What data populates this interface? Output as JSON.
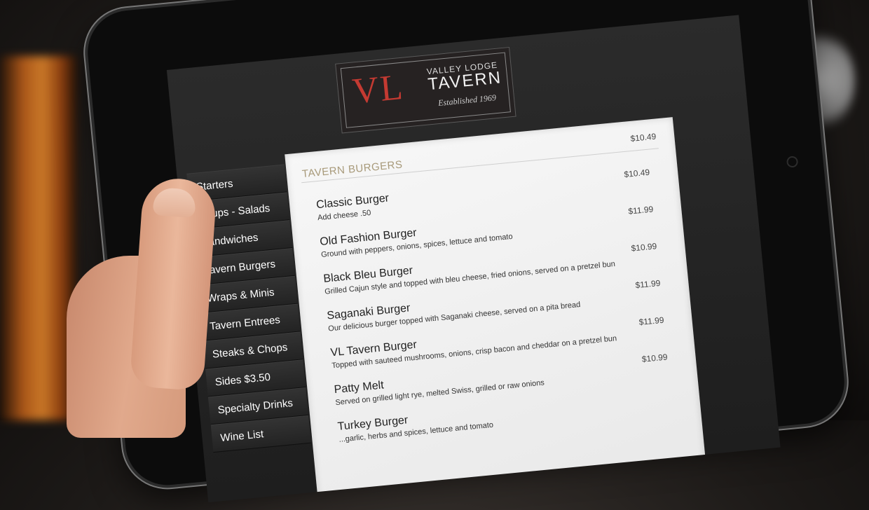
{
  "logo": {
    "initials": "VL",
    "line1": "VALLEY LODGE",
    "line2": "TAVERN",
    "tagline": "Established 1969"
  },
  "nav": [
    {
      "label": "Starters"
    },
    {
      "label": "Soups - Salads"
    },
    {
      "label": "Sandwiches"
    },
    {
      "label": "Tavern Burgers"
    },
    {
      "label": "Wraps & Minis"
    },
    {
      "label": "Tavern Entrees"
    },
    {
      "label": "Steaks & Chops"
    },
    {
      "label": "Sides $3.50"
    },
    {
      "label": "Specialty Drinks"
    },
    {
      "label": "Wine List"
    }
  ],
  "section": {
    "title": "TAVERN BURGERS",
    "price": "$10.49"
  },
  "items": [
    {
      "name": "Classic Burger",
      "desc": "Add cheese .50",
      "price": "$10.49"
    },
    {
      "name": "Old Fashion Burger",
      "desc": "Ground with peppers, onions, spices, lettuce and tomato",
      "price": "$11.99"
    },
    {
      "name": "Black Bleu Burger",
      "desc": "Grilled Cajun style and topped with bleu cheese, fried onions, served on a pretzel bun",
      "price": "$10.99"
    },
    {
      "name": "Saganaki Burger",
      "desc": "Our delicious burger topped with Saganaki cheese, served on a pita bread",
      "price": "$11.99"
    },
    {
      "name": "VL Tavern Burger",
      "desc": "Topped with sauteed mushrooms, onions, crisp bacon and cheddar on a pretzel bun",
      "price": "$11.99"
    },
    {
      "name": "Patty Melt",
      "desc": "Served on grilled light rye, melted Swiss, grilled or raw onions",
      "price": "$10.99"
    },
    {
      "name": "Turkey Burger",
      "desc": "...garlic, herbs and spices, lettuce and tomato",
      "price": ""
    }
  ],
  "colors": {
    "accent": "#c43a32",
    "section_title": "#a89a7a"
  }
}
